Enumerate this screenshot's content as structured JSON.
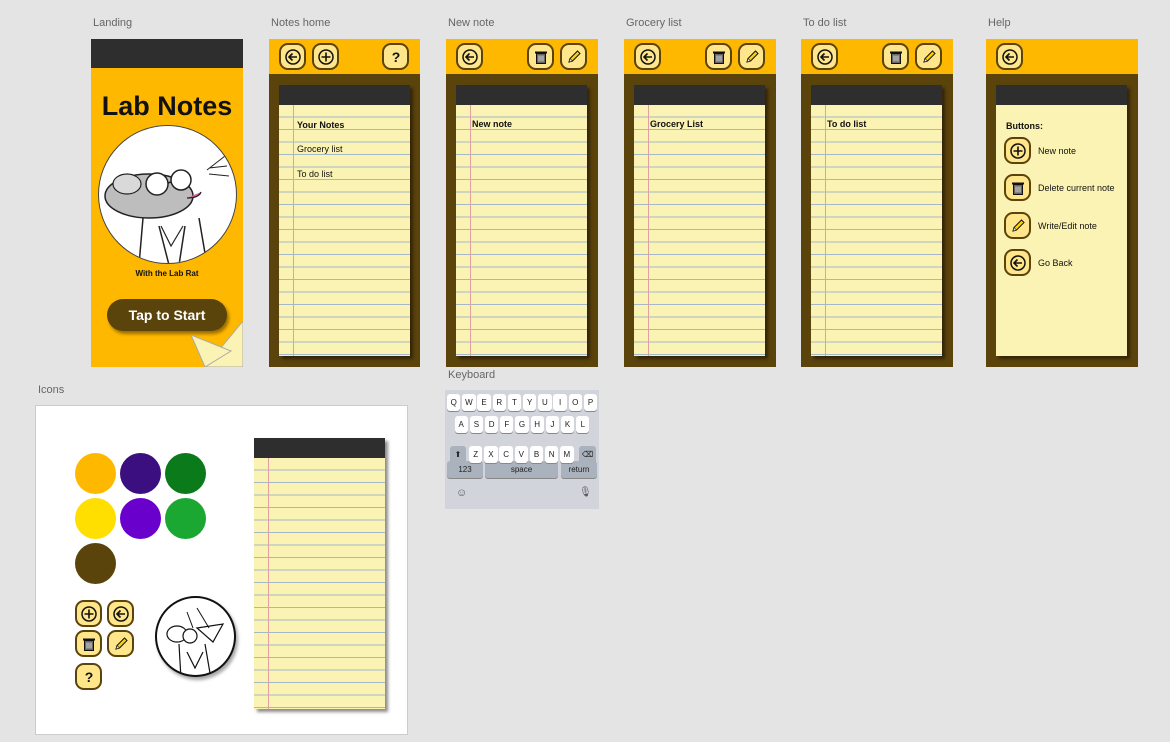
{
  "frames": {
    "landing": {
      "label": "Landing",
      "title": "Lab Notes",
      "subtitle": "With the Lab Rat",
      "cta": "Tap to Start"
    },
    "notes_home": {
      "label": "Notes home",
      "items": [
        "Your Notes",
        "Grocery list",
        "To do list"
      ]
    },
    "new_note": {
      "label": "New note",
      "heading": "New note"
    },
    "grocery": {
      "label": "Grocery list",
      "heading": "Grocery List"
    },
    "todo": {
      "label": "To do list",
      "heading": "To do list"
    },
    "help": {
      "label": "Help",
      "heading": "Buttons:",
      "items": [
        {
          "icon": "plus-icon",
          "text": "New note"
        },
        {
          "icon": "trash-icon",
          "text": "Delete current note"
        },
        {
          "icon": "pencil-icon",
          "text": "Write/Edit note"
        },
        {
          "icon": "back-arrow-icon",
          "text": "Go Back"
        }
      ]
    },
    "keyboard": {
      "label": "Keyboard",
      "row1": [
        "Q",
        "W",
        "E",
        "R",
        "T",
        "Y",
        "U",
        "I",
        "O",
        "P"
      ],
      "row2": [
        "A",
        "S",
        "D",
        "F",
        "G",
        "H",
        "J",
        "K",
        "L"
      ],
      "row3": [
        "Z",
        "X",
        "C",
        "V",
        "B",
        "N",
        "M"
      ],
      "k123": "123",
      "space": "space",
      "return": "return"
    },
    "icons": {
      "label": "Icons"
    }
  },
  "colors": {
    "amber": "#ffb800",
    "brown": "#5b430c",
    "paper": "#fbf3b3",
    "dark_purple": "#3b0f80",
    "green": "#0b7a1a",
    "yellow": "#ffdf00",
    "purple": "#6a00cc",
    "light_green": "#1aa832"
  },
  "palette": [
    "#ffb800",
    "#3b0f80",
    "#0b7a1a",
    "#ffdf00",
    "#6a00cc",
    "#1aa832",
    "#5b430c"
  ]
}
